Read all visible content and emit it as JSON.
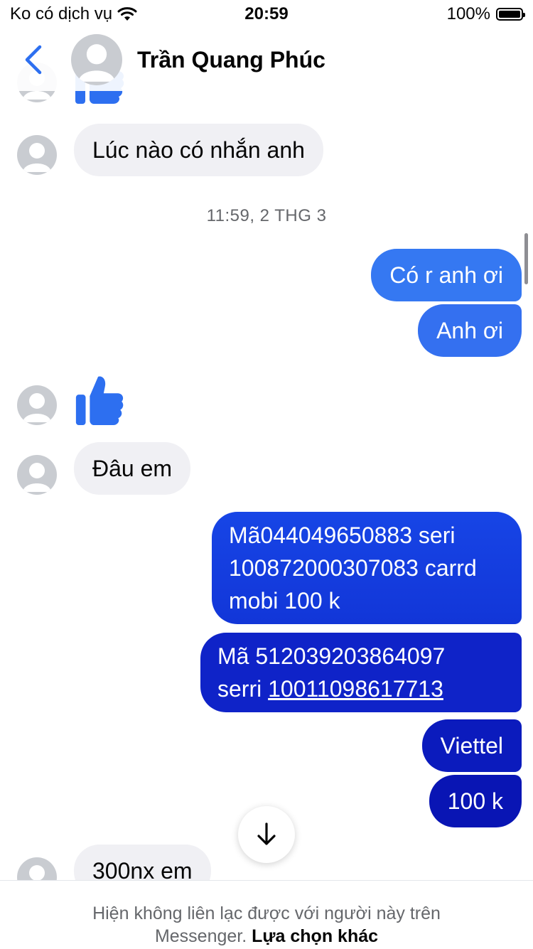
{
  "status_bar": {
    "carrier": "Ko có dịch vụ",
    "time": "20:59",
    "battery": "100%"
  },
  "header": {
    "contact_name": "Trần Quang Phúc"
  },
  "messages": {
    "incoming_1": "Lúc nào có nhắn anh",
    "timestamp": "11:59, 2 THG 3",
    "outgoing_1": "Có r anh ơi",
    "outgoing_2": "Anh ơi",
    "incoming_2": "Đâu em",
    "outgoing_3_line1": "Mã044049650883 seri",
    "outgoing_3_line2": "100872000307083 carrd",
    "outgoing_3_line3": "mobi 100 k",
    "outgoing_4_line1": "Mã 512039203864097",
    "outgoing_4_prefix": "serri ",
    "outgoing_4_link": "10011098617713",
    "outgoing_5": "Viettel",
    "outgoing_6": "100 k",
    "incoming_3": "300nx em"
  },
  "footer": {
    "notice_line1": "Hiện không liên lạc được với người này trên",
    "notice_line2": "Messenger.",
    "link": "Lựa chọn khác"
  },
  "colors": {
    "bubble_blue_light": "#3578f2",
    "bubble_blue_dark": "#0a17b8",
    "like_blue": "#2d6ff0"
  }
}
